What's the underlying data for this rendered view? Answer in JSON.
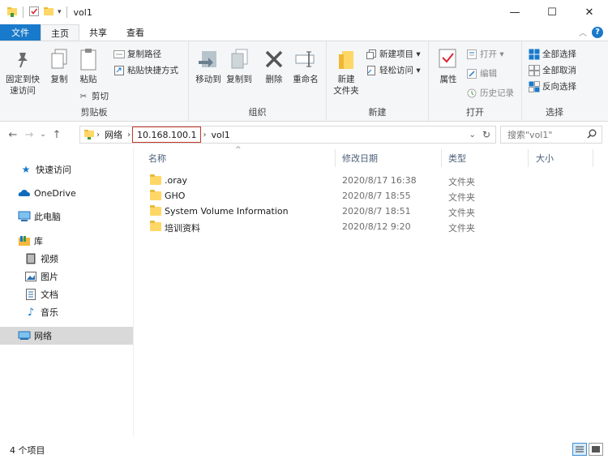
{
  "window": {
    "title": "vol1",
    "minimize": "—",
    "maximize": "☐",
    "close": "✕"
  },
  "ribbon_tabs": {
    "file": "文件",
    "home": "主页",
    "share": "共享",
    "view": "查看"
  },
  "ribbon": {
    "clipboard": {
      "label": "剪贴板",
      "pin": "固定到快\n速访问",
      "copy": "复制",
      "paste": "粘贴",
      "copy_path": "复制路径",
      "paste_shortcut": "粘贴快捷方式",
      "cut": "剪切"
    },
    "organize": {
      "label": "组织",
      "move_to": "移动到",
      "copy_to": "复制到",
      "delete": "删除",
      "rename": "重命名"
    },
    "new": {
      "label": "新建",
      "new_folder": "新建\n文件夹",
      "new_item": "新建项目 ▾",
      "easy_access": "轻松访问 ▾"
    },
    "open": {
      "label": "打开",
      "properties": "属性",
      "open": "打开 ▾",
      "edit": "编辑",
      "history": "历史记录"
    },
    "select": {
      "label": "选择",
      "select_all": "全部选择",
      "select_none": "全部取消",
      "invert": "反向选择"
    }
  },
  "address": {
    "crumbs": [
      "网络",
      "10.168.100.1",
      "vol1"
    ],
    "search_placeholder": "搜索\"vol1\""
  },
  "nav_pane": {
    "quick_access": "快速访问",
    "onedrive": "OneDrive",
    "this_pc": "此电脑",
    "libraries": "库",
    "videos": "视频",
    "pictures": "图片",
    "documents": "文档",
    "music": "音乐",
    "network": "网络"
  },
  "columns": {
    "name": "名称",
    "date": "修改日期",
    "type": "类型",
    "size": "大小"
  },
  "files": [
    {
      "name": ".oray",
      "date": "2020/8/17 16:38",
      "type": "文件夹"
    },
    {
      "name": "GHO",
      "date": "2020/8/7 18:55",
      "type": "文件夹"
    },
    {
      "name": "System Volume Information",
      "date": "2020/8/7 18:51",
      "type": "文件夹"
    },
    {
      "name": "培训资料",
      "date": "2020/8/12 9:20",
      "type": "文件夹"
    }
  ],
  "status": {
    "count": "4 个项目"
  },
  "colors": {
    "accent": "#1979ca",
    "highlight_border": "#c0392b",
    "folder": "#ffd766"
  }
}
